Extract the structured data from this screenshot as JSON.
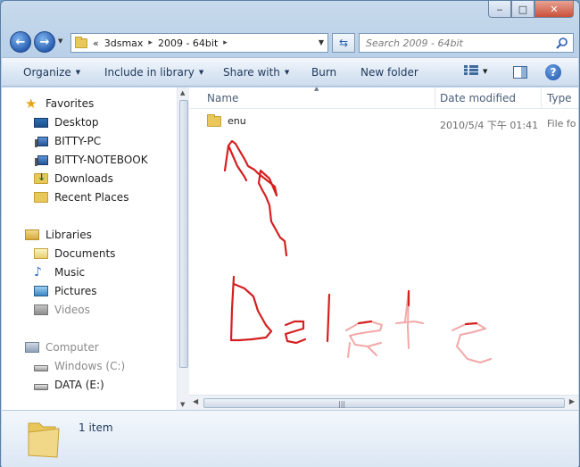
{
  "window": {
    "caption_buttons": {
      "minimize": "‒",
      "maximize": "□",
      "close": "✕"
    }
  },
  "address": {
    "overflow": "«",
    "crumbs": [
      "3dsmax",
      "2009 - 64bit"
    ],
    "separator": "▸"
  },
  "search": {
    "placeholder": "Search 2009 - 64bit"
  },
  "toolbar": {
    "organize": "Organize",
    "include_in_library": "Include in library",
    "share_with": "Share with",
    "burn": "Burn",
    "new_folder": "New folder",
    "help": "?"
  },
  "nav": {
    "favorites": {
      "header": "Favorites",
      "items": [
        "Desktop",
        "BITTY-PC",
        "BITTY-NOTEBOOK",
        "Downloads",
        "Recent Places"
      ]
    },
    "libraries": {
      "header": "Libraries",
      "items": [
        "Documents",
        "Music",
        "Pictures",
        "Videos"
      ]
    },
    "computer": {
      "header": "Computer",
      "items": [
        "Windows (C:)",
        "DATA (E:)"
      ]
    }
  },
  "columns": [
    "Name",
    "Date modified",
    "Type"
  ],
  "files": [
    {
      "name": "enu",
      "date_modified": "2010/5/4 下午 01:41",
      "type": "File fo"
    }
  ],
  "annotation": {
    "text": "Delete",
    "color": "#d42020"
  },
  "status": {
    "count": "1 item"
  },
  "icons": [
    "back-arrow-icon",
    "forward-arrow-icon",
    "folder-icon",
    "refresh-icon",
    "search-icon",
    "view-icon",
    "preview-pane-icon",
    "help-icon",
    "star-icon",
    "desktop-icon",
    "computer-icon",
    "library-icon",
    "music-icon",
    "drive-icon"
  ]
}
